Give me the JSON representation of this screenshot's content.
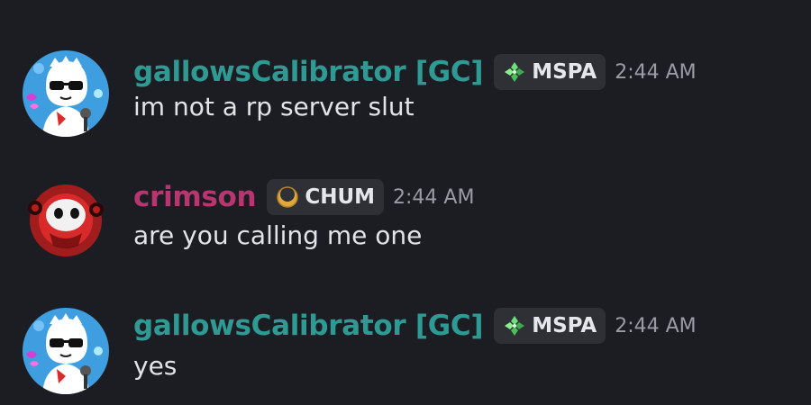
{
  "colors": {
    "background": "#1c1d22",
    "gc_name": "#2e9a93",
    "crimson_name": "#b8366f",
    "tag_bg": "#2f3036",
    "timestamp": "#9a9ca5",
    "text": "#e2e3e7"
  },
  "messages": [
    {
      "username": "gallowsCalibrator [GC]",
      "role_tag": "MSPA",
      "role_icon": "green-diamond-cluster-icon",
      "timestamp": "2:44 AM",
      "content": "im not a rp server slut"
    },
    {
      "username": "crimson",
      "role_tag": "CHUM",
      "role_icon": "gold-crescent-icon",
      "timestamp": "2:44 AM",
      "content": "are you calling me one"
    },
    {
      "username": "gallowsCalibrator [GC]",
      "role_tag": "MSPA",
      "role_icon": "green-diamond-cluster-icon",
      "timestamp": "2:44 AM",
      "content": "yes"
    }
  ]
}
